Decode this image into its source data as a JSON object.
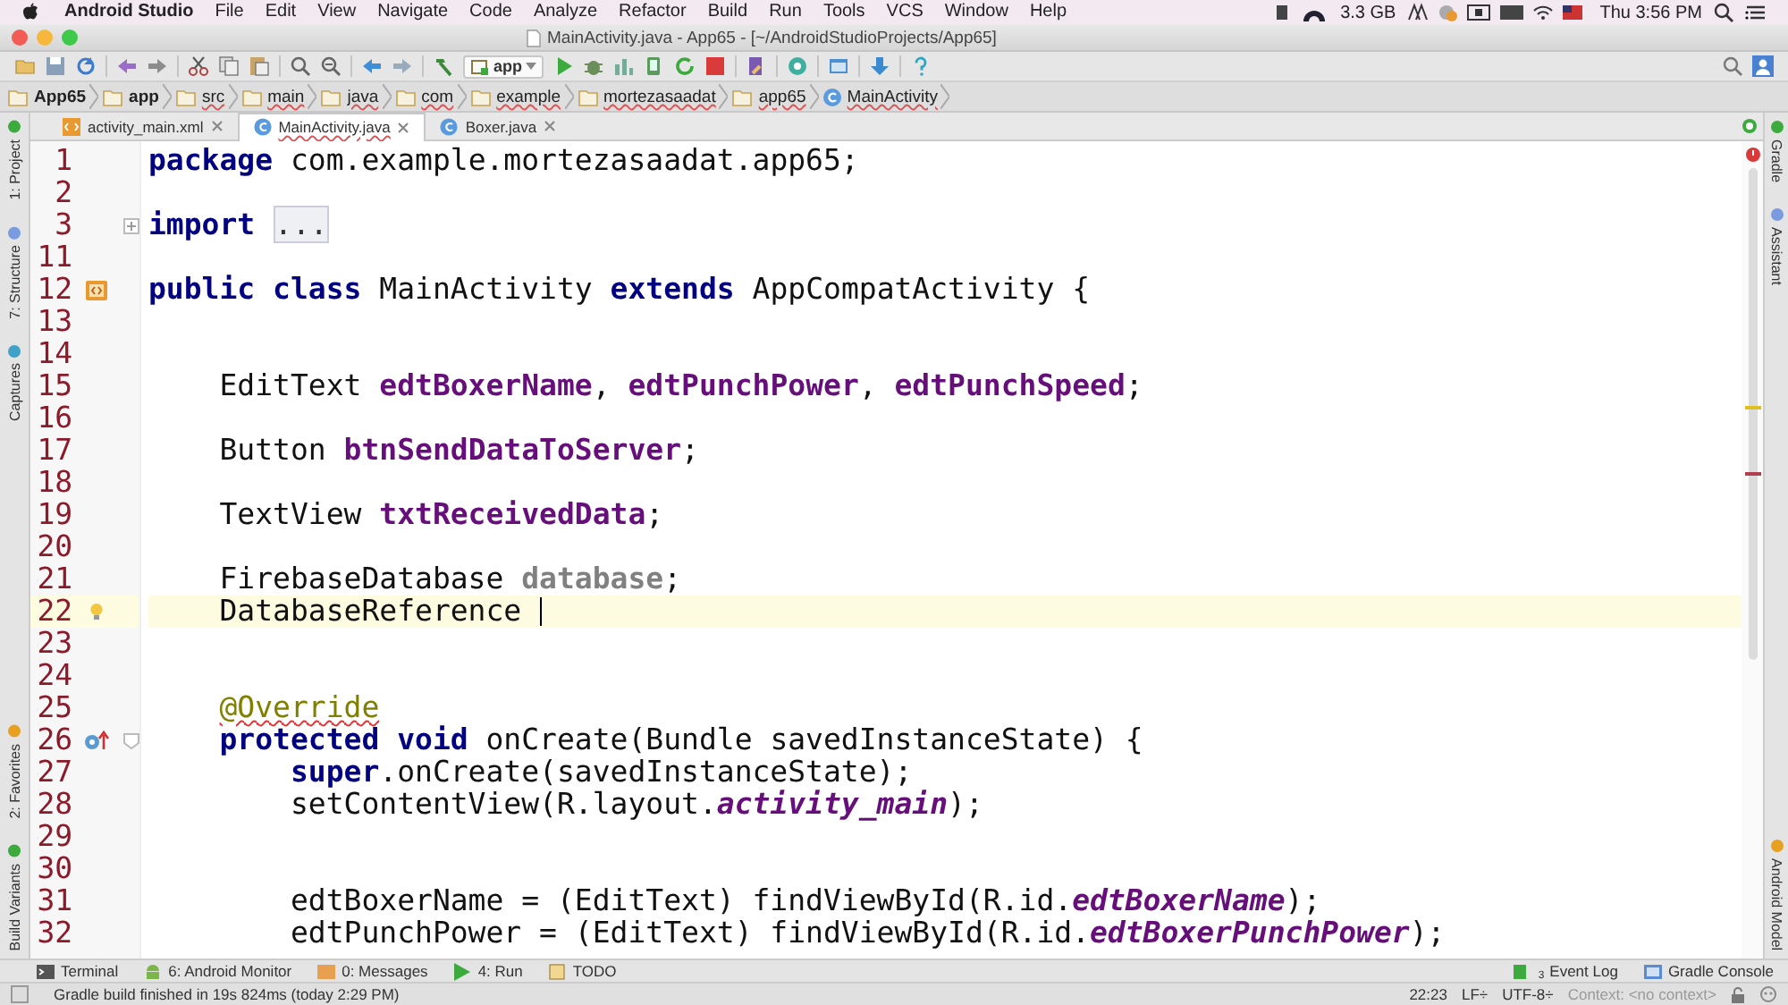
{
  "menu_bar": {
    "app_name": "Android Studio",
    "items": [
      "File",
      "Edit",
      "View",
      "Navigate",
      "Code",
      "Analyze",
      "Refactor",
      "Build",
      "Run",
      "Tools",
      "VCS",
      "Window",
      "Help"
    ],
    "memory": "3.3 GB",
    "clock": "Thu 3:56 PM"
  },
  "window": {
    "title": "MainActivity.java - App65 - [~/AndroidStudioProjects/App65]"
  },
  "toolbar": {
    "run_config": "app"
  },
  "breadcrumbs": [
    {
      "label": "App65",
      "kind": "folder"
    },
    {
      "label": "app",
      "kind": "folder"
    },
    {
      "label": "src",
      "kind": "folder"
    },
    {
      "label": "main",
      "kind": "folder"
    },
    {
      "label": "java",
      "kind": "folder"
    },
    {
      "label": "com",
      "kind": "folder"
    },
    {
      "label": "example",
      "kind": "folder"
    },
    {
      "label": "mortezasaadat",
      "kind": "folder"
    },
    {
      "label": "app65",
      "kind": "folder"
    },
    {
      "label": "MainActivity",
      "kind": "class"
    }
  ],
  "tabs": [
    {
      "label": "activity_main.xml",
      "kind": "xml",
      "selected": false
    },
    {
      "label": "MainActivity.java",
      "kind": "class",
      "selected": true
    },
    {
      "label": "Boxer.java",
      "kind": "class",
      "selected": false
    }
  ],
  "left_strip": {
    "top": [
      "1: Project",
      "7: Structure",
      "Captures"
    ],
    "bottom": [
      "2: Favorites",
      "Build Variants"
    ]
  },
  "right_strip": {
    "top": [
      "Gradle",
      "Assistant"
    ],
    "bottom": [
      "Android Model"
    ]
  },
  "editor": {
    "lines": [
      {
        "number": "1",
        "current": false,
        "segments": [
          {
            "text": "package",
            "kind": "keyword"
          },
          {
            "text": " com.example.mortezasaadat.app65;",
            "kind": "plain"
          }
        ]
      },
      {
        "number": "2",
        "current": false
      },
      {
        "number": "3",
        "current": false,
        "fold": {
          "kind": "expand"
        },
        "segments": [
          {
            "text": "import ",
            "kind": "keyword"
          },
          {
            "text": "...",
            "kind": "folded"
          }
        ]
      },
      {
        "number": "11",
        "current": false
      },
      {
        "number": "12",
        "current": false,
        "gutter_icon": {
          "kind": "class"
        },
        "segments": [
          {
            "text": "public class",
            "kind": "keyword"
          },
          {
            "text": " MainActivity ",
            "kind": "plain"
          },
          {
            "text": "extends",
            "kind": "keyword"
          },
          {
            "text": " AppCompatActivity {",
            "kind": "plain"
          }
        ]
      },
      {
        "number": "13",
        "current": false
      },
      {
        "number": "14",
        "current": false
      },
      {
        "number": "15",
        "current": false,
        "segments": [
          {
            "text": "    EditText ",
            "kind": "plain"
          },
          {
            "text": "edtBoxerName",
            "kind": "field"
          },
          {
            "text": ", ",
            "kind": "plain"
          },
          {
            "text": "edtPunchPower",
            "kind": "field"
          },
          {
            "text": ", ",
            "kind": "plain"
          },
          {
            "text": "edtPunchSpeed",
            "kind": "field"
          },
          {
            "text": ";",
            "kind": "plain"
          }
        ]
      },
      {
        "number": "16",
        "current": false
      },
      {
        "number": "17",
        "current": false,
        "segments": [
          {
            "text": "    Button ",
            "kind": "plain"
          },
          {
            "text": "btnSendDataToServer",
            "kind": "field"
          },
          {
            "text": ";",
            "kind": "plain"
          }
        ]
      },
      {
        "number": "18",
        "current": false
      },
      {
        "number": "19",
        "current": false,
        "segments": [
          {
            "text": "    TextView ",
            "kind": "plain"
          },
          {
            "text": "txtReceivedData",
            "kind": "field"
          },
          {
            "text": ";",
            "kind": "plain"
          }
        ]
      },
      {
        "number": "20",
        "current": false
      },
      {
        "number": "21",
        "current": false,
        "segments": [
          {
            "text": "    FirebaseDatabase ",
            "kind": "plain"
          },
          {
            "text": "database",
            "kind": "unused"
          },
          {
            "text": ";",
            "kind": "plain"
          }
        ]
      },
      {
        "number": "22",
        "current": true,
        "cursor": true,
        "gutter_icon": {
          "kind": "bulb"
        },
        "segments": [
          {
            "text": "    DatabaseReference ",
            "kind": "plain"
          }
        ]
      },
      {
        "number": "23",
        "current": false
      },
      {
        "number": "24",
        "current": false
      },
      {
        "number": "25",
        "current": false,
        "segments": [
          {
            "text": "    @Override",
            "kind": "annotation",
            "squiggle": true
          }
        ]
      },
      {
        "number": "26",
        "current": false,
        "gutter_icon": {
          "kind": "override"
        },
        "fold": {
          "kind": "collapse"
        },
        "segments": [
          {
            "text": "    protected void",
            "kind": "keyword"
          },
          {
            "text": " onCreate(Bundle savedInstanceState) {",
            "kind": "plain"
          }
        ]
      },
      {
        "number": "27",
        "current": false,
        "segments": [
          {
            "text": "        super",
            "kind": "keyword"
          },
          {
            "text": ".onCreate(savedInstanceState);",
            "kind": "plain"
          }
        ]
      },
      {
        "number": "28",
        "current": false,
        "segments": [
          {
            "text": "        setContentView(R.layout.",
            "kind": "plain"
          },
          {
            "text": "activity_main",
            "kind": "static"
          },
          {
            "text": ");",
            "kind": "plain"
          }
        ]
      },
      {
        "number": "29",
        "current": false
      },
      {
        "number": "30",
        "current": false
      },
      {
        "number": "31",
        "current": false,
        "segments": [
          {
            "text": "        edtBoxerName = (EditText) findViewById(R.id.",
            "kind": "plain"
          },
          {
            "text": "edtBoxerName",
            "kind": "static"
          },
          {
            "text": ");",
            "kind": "plain"
          }
        ]
      },
      {
        "number": "32",
        "current": false,
        "segments": [
          {
            "text": "        edtPunchPower = (EditText) findViewById(R.id.",
            "kind": "plain"
          },
          {
            "text": "edtBoxerPunchPower",
            "kind": "static"
          },
          {
            "text": ");",
            "kind": "plain"
          }
        ]
      }
    ]
  },
  "tool_windows": {
    "left": [
      {
        "label": "Terminal",
        "kind": "terminal"
      },
      {
        "label": "6: Android Monitor",
        "kind": "android"
      },
      {
        "label": "0: Messages",
        "kind": "messages"
      },
      {
        "label": "4: Run",
        "kind": "run"
      },
      {
        "label": "TODO",
        "kind": "todo"
      }
    ],
    "right": [
      {
        "label": "Event Log",
        "kind": "log",
        "count": "3"
      },
      {
        "label": "Gradle Console",
        "kind": "console"
      }
    ]
  },
  "status_bar": {
    "message": "Gradle build finished in 19s 824ms (today 2:29 PM)",
    "position": "22:23",
    "line_separator": "LF÷",
    "encoding": "UTF-8÷",
    "context": "Context: <no context>"
  }
}
